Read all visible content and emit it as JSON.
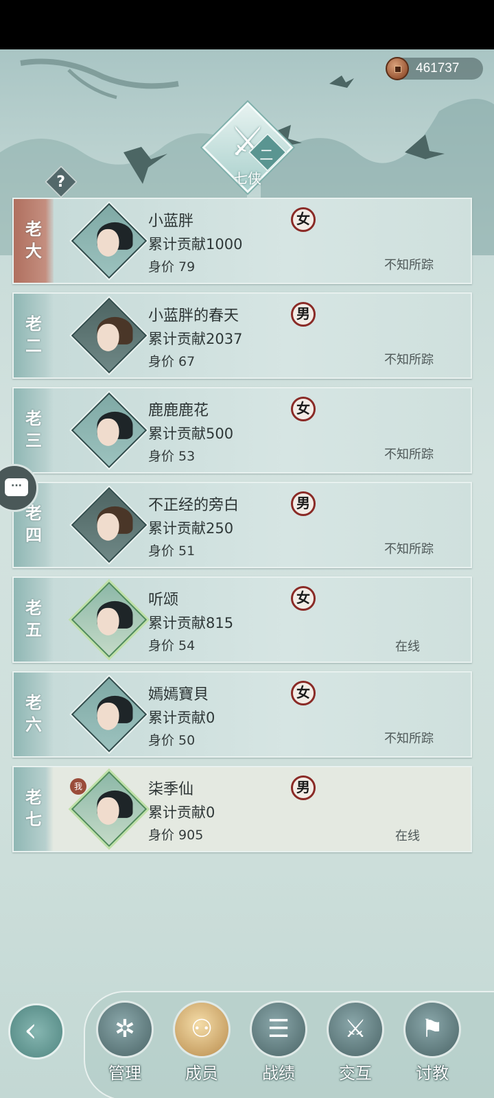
{
  "currency": {
    "value": "461737",
    "icon": "copper-coin-icon"
  },
  "faction": {
    "name": "七侠",
    "rank": "二"
  },
  "help": {
    "label": "?"
  },
  "members": [
    {
      "rank": "老大",
      "name": "小蓝胖",
      "contribution": "累计贡献1000",
      "price": "身价 79",
      "gender": "女",
      "status": "不知所踪"
    },
    {
      "rank": "老二",
      "name": "小蓝胖的春天",
      "contribution": "累计贡献2037",
      "price": "身价 67",
      "gender": "男",
      "status": "不知所踪"
    },
    {
      "rank": "老三",
      "name": "鹿鹿鹿花",
      "contribution": "累计贡献500",
      "price": "身价 53",
      "gender": "女",
      "status": "不知所踪"
    },
    {
      "rank": "老四",
      "name": "不正经的旁白",
      "contribution": "累计贡献250",
      "price": "身价 51",
      "gender": "男",
      "status": "不知所踪"
    },
    {
      "rank": "老五",
      "name": "听颂",
      "contribution": "累计贡献815",
      "price": "身价 54",
      "gender": "女",
      "status": "在线"
    },
    {
      "rank": "老六",
      "name": "嫣嫣寶貝",
      "contribution": "累计贡献0",
      "price": "身价 50",
      "gender": "女",
      "status": "不知所踪"
    },
    {
      "rank": "老七",
      "name": "柒季仙",
      "contribution": "累计贡献0",
      "price": "身价 905",
      "gender": "男",
      "status": "在线",
      "me_badge": "我"
    }
  ],
  "chat": {
    "label": "···"
  },
  "back": {
    "glyph": "‹"
  },
  "nav": [
    {
      "label": "管理",
      "icon": "manage-icon",
      "glyph": "✲"
    },
    {
      "label": "成员",
      "icon": "members-icon",
      "glyph": "⚇"
    },
    {
      "label": "战绩",
      "icon": "record-scroll-icon",
      "glyph": "☰"
    },
    {
      "label": "交互",
      "icon": "interact-icon",
      "glyph": "⚔"
    },
    {
      "label": "讨教",
      "icon": "spar-icon",
      "glyph": "⚑"
    }
  ]
}
